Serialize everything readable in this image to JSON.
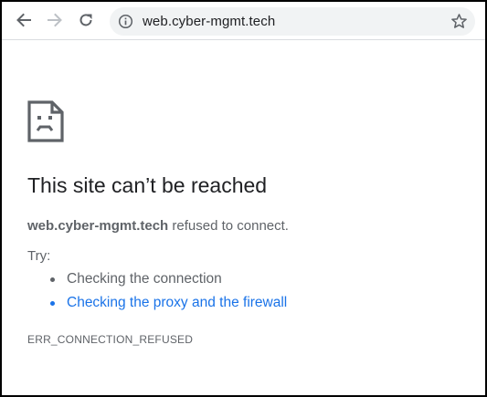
{
  "browser": {
    "url": "web.cyber-mgmt.tech",
    "icons": {
      "back": "back-arrow-icon",
      "forward": "forward-arrow-icon",
      "reload": "reload-icon",
      "info": "info-icon",
      "bookmark": "star-icon"
    }
  },
  "error_page": {
    "icon": "sad-page-icon",
    "title": "This site can’t be reached",
    "host": "web.cyber-mgmt.tech",
    "message": " refused to connect.",
    "try_label": "Try:",
    "suggestions": [
      "Checking the connection",
      "Checking the proxy and the firewall"
    ],
    "error_code": "ERR_CONNECTION_REFUSED"
  },
  "colors": {
    "text_primary": "#202124",
    "text_secondary": "#5f6368",
    "link": "#1a73e8",
    "omnibox_bg": "#f1f3f4"
  }
}
